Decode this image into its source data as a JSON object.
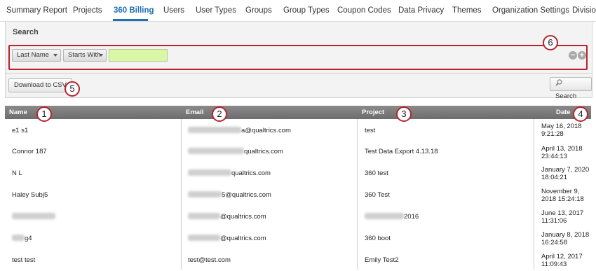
{
  "tabs": [
    {
      "label": "Summary Report",
      "active": false
    },
    {
      "label": "Projects",
      "active": false
    },
    {
      "label": "360 Billing",
      "active": true
    },
    {
      "label": "Users",
      "active": false
    },
    {
      "label": "User Types",
      "active": false
    },
    {
      "label": "Groups",
      "active": false
    },
    {
      "label": "Group Types",
      "active": false
    },
    {
      "label": "Coupon Codes",
      "active": false
    },
    {
      "label": "Data Privacy",
      "active": false
    },
    {
      "label": "Themes",
      "active": false
    },
    {
      "label": "Organization Settings",
      "active": false
    },
    {
      "label": "Division",
      "active": false
    }
  ],
  "search": {
    "title": "Search",
    "field_select": "Last Name",
    "operator_select": "Starts With",
    "value": "",
    "remove_icon": "minus-circle-icon",
    "add_icon": "plus-circle-icon"
  },
  "actions": {
    "download_label": "Download to CSV",
    "search_label": "Search",
    "search_icon": "magnifier-icon"
  },
  "callouts": [
    "1",
    "2",
    "3",
    "4",
    "5",
    "6"
  ],
  "table": {
    "columns": [
      "Name",
      "Email",
      "Project",
      "Date"
    ],
    "rows": [
      {
        "name": "e1 s1",
        "email": "a@qualtrics.com",
        "project": "test",
        "date1": "May 16, 2018",
        "date2": "9:21:28"
      },
      {
        "name": "Connor 187",
        "email": "qualtrics.com",
        "project": "Test Data Export 4.13.18",
        "date1": "April 13, 2018",
        "date2": "23:44:13"
      },
      {
        "name": "N L",
        "email": "qualtrics.com",
        "project": "360 test",
        "date1": "January 7, 2020",
        "date2": "18:04:21"
      },
      {
        "name": "Haley Subj5",
        "email": "5@qualtrics.com",
        "project": "360 Test",
        "date1": "November 9,",
        "date2": "2018 15:24:18"
      },
      {
        "name": "",
        "email": "@qualtrics.com",
        "project": "2016",
        "date1": "June 13, 2017",
        "date2": "11:31:06"
      },
      {
        "name": "g4",
        "email": "@qualtrics.com",
        "project": "360 boot",
        "date1": "January 8, 2018",
        "date2": "16:24:58"
      },
      {
        "name": "test test",
        "email": "test@test.com",
        "project": "Emily Test2",
        "date1": "April 12, 2017",
        "date2": "11:09:43"
      }
    ]
  },
  "colors": {
    "accent": "#1f6fb2",
    "callout": "#b8232f",
    "input_fill": "#d9f7a6",
    "header_bg": "#7a7a7a"
  }
}
